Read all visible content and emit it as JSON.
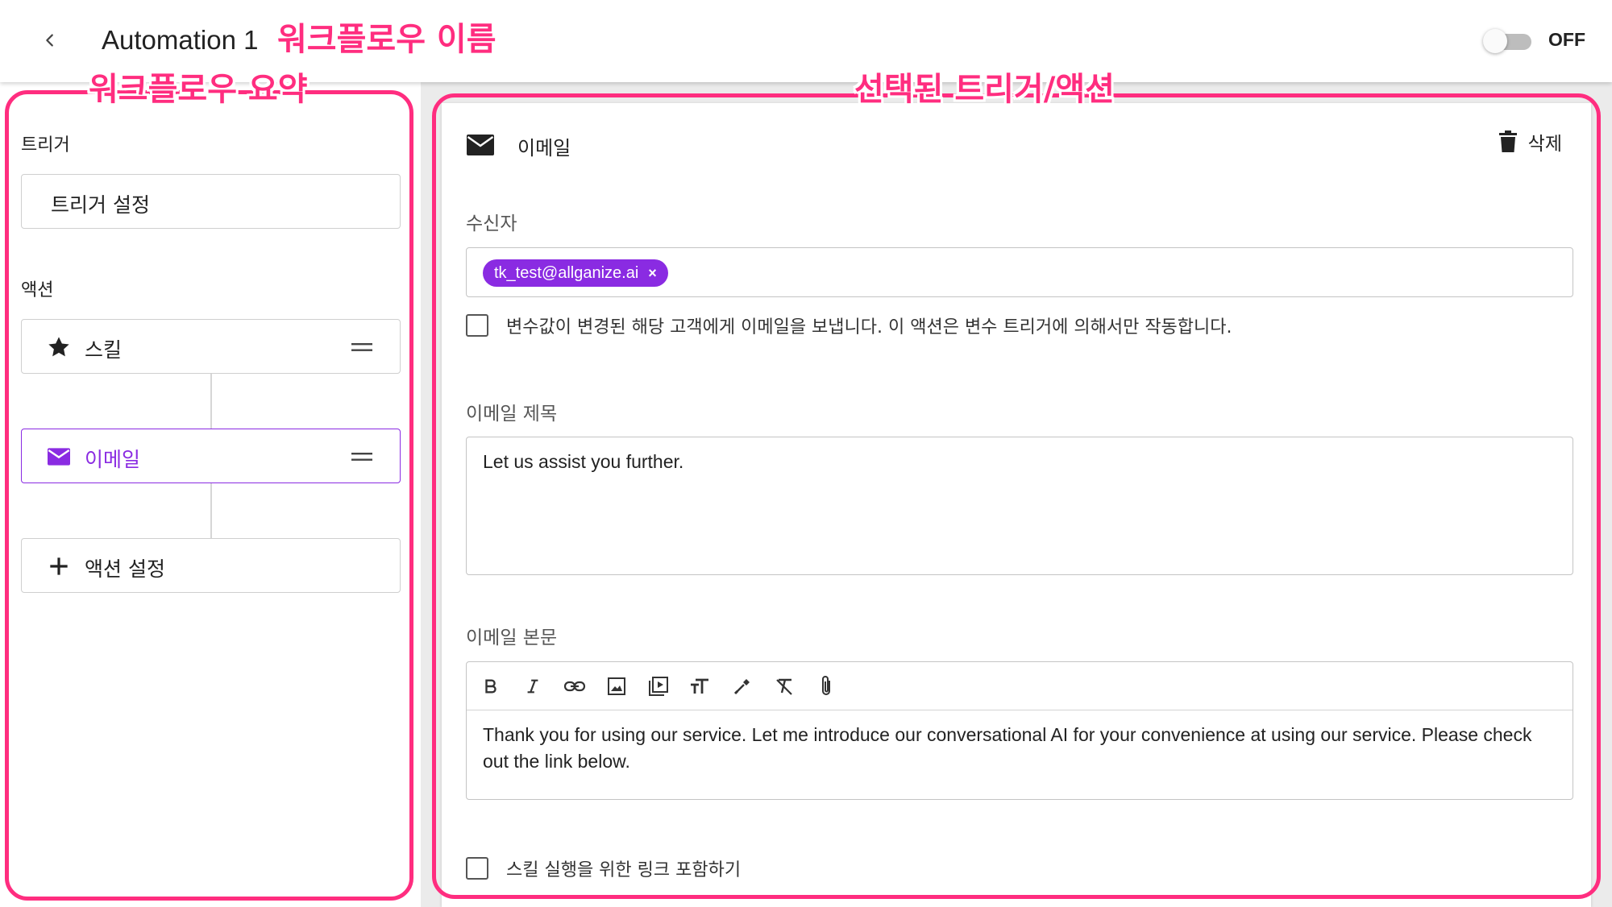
{
  "header": {
    "title": "Automation 1",
    "toggle_label": "OFF"
  },
  "annotations": {
    "workflow_name": "워크플로우 이름",
    "workflow_summary": "워크플로우 요약",
    "selected_item": "선택된 트리거/액션",
    "color": "#ff2d7f"
  },
  "sidebar": {
    "trigger_section": "트리거",
    "trigger_card": "트리거 설정",
    "action_section": "액션",
    "actions": [
      {
        "label": "스킬",
        "icon": "star-icon"
      },
      {
        "label": "이메일",
        "icon": "mail-icon",
        "selected": true
      }
    ],
    "add_action": "액션 설정"
  },
  "detail": {
    "title": "이메일",
    "delete_label": "삭제",
    "recipient_label": "수신자",
    "recipient_chip": "tk_test@allganize.ai",
    "chip_remove": "×",
    "checkbox_variable": "변수값이 변경된 해당 고객에게 이메일을 보냅니다. 이 액션은 변수 트리거에 의해서만 작동합니다.",
    "subject_label": "이메일 제목",
    "subject_value": "Let us assist you further.",
    "body_label": "이메일 본문",
    "body_line1": "Thank you for using our service. Let me introduce our conversational AI for your convenience at using our service. Please check",
    "body_line2": "out the link below.",
    "checkbox_skill_link": "스킬 실행을 위한 링크 포함하기"
  },
  "colors": {
    "accent": "#8a2be2",
    "annotation": "#ff2d7f"
  }
}
